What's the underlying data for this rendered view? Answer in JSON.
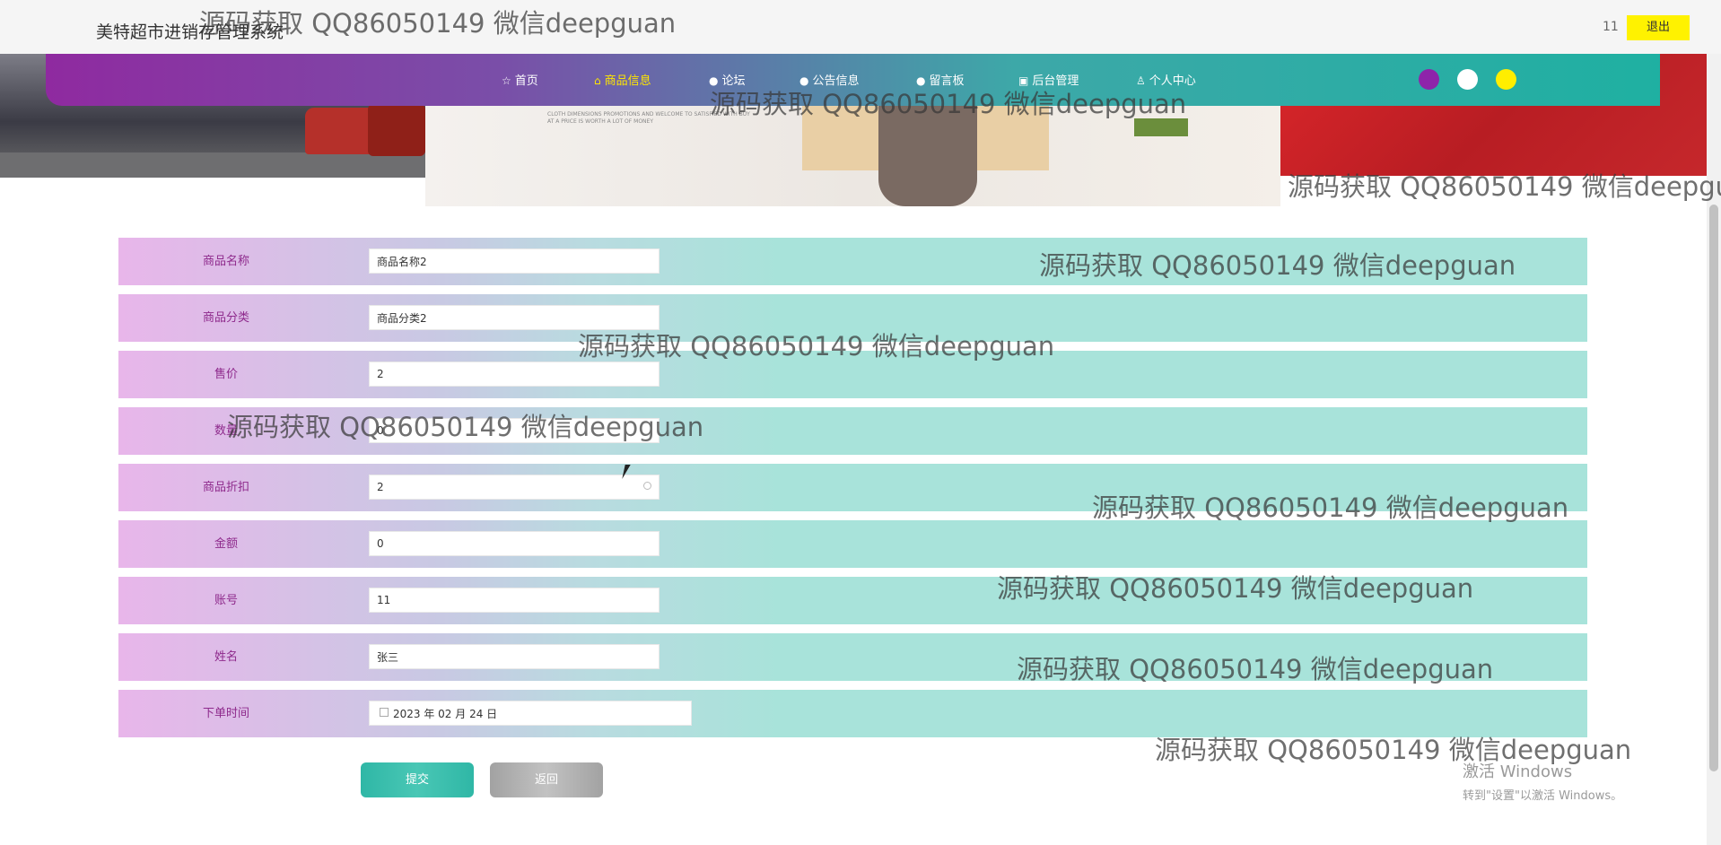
{
  "header": {
    "app_title": "美特超市进销存管理系统",
    "user_name": "11",
    "logout_label": "退出"
  },
  "nav": {
    "items": [
      {
        "label": "首页",
        "icon": "star-icon",
        "glyph": "☆"
      },
      {
        "label": "商品信息",
        "icon": "shopping-bag-icon",
        "glyph": "⌂"
      },
      {
        "label": "论坛",
        "icon": "forum-icon",
        "glyph": "●"
      },
      {
        "label": "公告信息",
        "icon": "announcement-icon",
        "glyph": "●"
      },
      {
        "label": "留言板",
        "icon": "info-icon",
        "glyph": "●"
      },
      {
        "label": "后台管理",
        "icon": "briefcase-icon",
        "glyph": "▣"
      },
      {
        "label": "个人中心",
        "icon": "user-icon",
        "glyph": "♙"
      }
    ],
    "active_index": 1,
    "theme_colors": [
      "#8e24aa",
      "#ffffff",
      "#ffee00"
    ]
  },
  "banner": {
    "promo_text": "CLOTH DIMENSIONS PROMOTIONS AND WELCOME TO SATISFIED WITH BUY AT A PRICE IS WORTH A LOT OF MONEY"
  },
  "form": {
    "rows": [
      {
        "label": "商品名称",
        "value": "商品名称2"
      },
      {
        "label": "商品分类",
        "value": "商品分类2"
      },
      {
        "label": "售价",
        "value": "2"
      },
      {
        "label": "数量",
        "value": "0"
      },
      {
        "label": "商品折扣",
        "value": "2"
      },
      {
        "label": "金额",
        "value": "0"
      },
      {
        "label": "账号",
        "value": "11"
      },
      {
        "label": "姓名",
        "value": "张三"
      },
      {
        "label": "下单时间",
        "value": "2023 年 02 月 24 日"
      }
    ],
    "submit_label": "提交",
    "back_label": "返回"
  },
  "watermark": "源码获取 QQ86050149 微信deepguan",
  "windows_activation": {
    "title": "激活 Windows",
    "subtitle": "转到\"设置\"以激活 Windows。"
  },
  "colors": {
    "accent": "#1fb0a2",
    "nav_start": "#8f2aa0",
    "logout_bg": "#fff200",
    "label_text": "#8e2a8c"
  }
}
